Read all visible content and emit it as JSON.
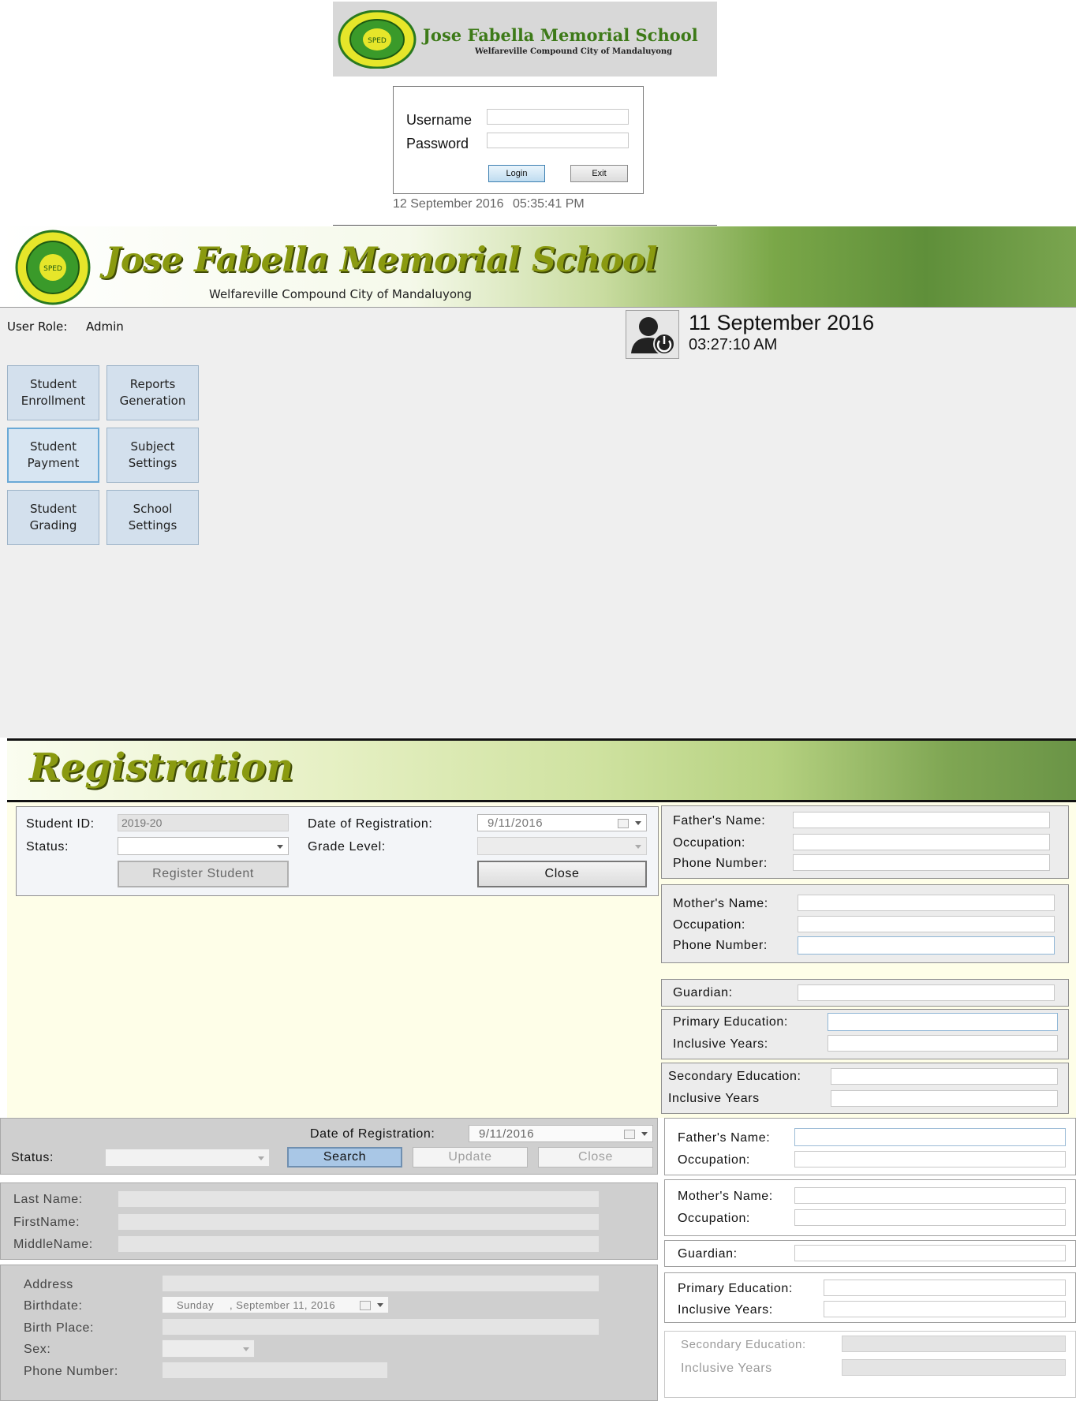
{
  "login": {
    "school_name": "Jose Fabella Memorial School",
    "address": "Welfareville Compound City of Mandaluyong",
    "username_label": "Username",
    "password_label": "Password",
    "username_value": "",
    "password_value": "",
    "login_button": "Login",
    "exit_button": "Exit",
    "timestamp_date": "12 September 2016",
    "timestamp_time": "05:35:41 PM"
  },
  "dashboard": {
    "school_name": "Jose Fabella Memorial School",
    "address": "Welfareville Compound City of Mandaluyong",
    "user_role_label": "User Role:",
    "user_role_value": "Admin",
    "date": "11 September 2016",
    "time": "03:27:10 AM",
    "nav": [
      {
        "label": "Student\nEnrollment"
      },
      {
        "label": "Reports\nGeneration"
      },
      {
        "label": "Student\nPayment"
      },
      {
        "label": "Subject\nSettings"
      },
      {
        "label": "Student\nGrading"
      },
      {
        "label": "School\nSettings"
      }
    ]
  },
  "registration": {
    "title": "Registration",
    "student_id_label": "Student ID:",
    "student_id_value": "2019-20",
    "status_label": "Status:",
    "date_label": "Date of Registration:",
    "date_value": "9/11/2016",
    "grade_label": "Grade Level:",
    "register_button": "Register Student",
    "close_button": "Close",
    "father_label": "Father's Name:",
    "occupation_label": "Occupation:",
    "phone_label": "Phone Number:",
    "mother_label": "Mother's Name:",
    "guardian_label": "Guardian:",
    "primary_label": "Primary Education:",
    "inclusive_label": "Inclusive Years:",
    "secondary_label": "Secondary Education:",
    "inclusive_label2": "Inclusive Years"
  },
  "lower_form": {
    "date_label": "Date of Registration:",
    "date_value": "9/11/2016",
    "status_label": "Status:",
    "search_button": "Search",
    "update_button": "Update",
    "close_button": "Close",
    "last_name_label": "Last Name:",
    "first_name_label": "FirstName:",
    "middle_name_label": "MiddleName:",
    "address_label": "Address",
    "birthdate_label": "Birthdate:",
    "birthdate_day": "Sunday",
    "birthdate_value": ", September 11, 2016",
    "birthplace_label": "Birth Place:",
    "sex_label": "Sex:",
    "phone_label": "Phone Number:",
    "father_label": "Father's Name:",
    "occupation_label": "Occupation:",
    "mother_label": "Mother's Name:",
    "guardian_label": "Guardian:",
    "primary_label": "Primary Education:",
    "inclusive_label": "Inclusive Years:",
    "secondary_label": "Secondary Education:",
    "inclusive_label2": "Inclusive Years"
  }
}
